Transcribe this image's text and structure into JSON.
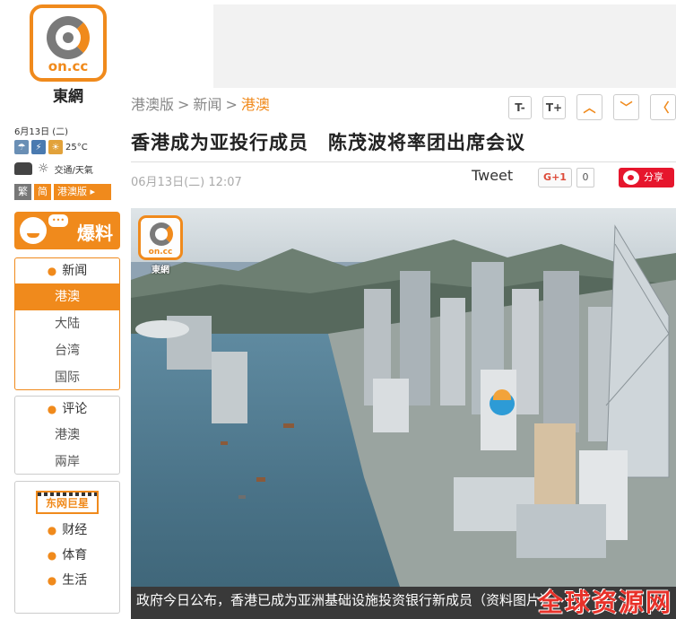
{
  "site": {
    "logo_text": "on.cc",
    "name": "東網"
  },
  "sidebar": {
    "date": "6月13日 (二)",
    "temperature": "25°C",
    "traffic_weather": "交通/天氣",
    "lang": {
      "traditional": "繁",
      "simplified": "简",
      "edition": "港澳版 ▸"
    },
    "baoliao": {
      "bubble": "•••",
      "label": "爆料"
    },
    "news": {
      "header": "新闻",
      "items": [
        "港澳",
        "大陆",
        "台湾",
        "国际"
      ]
    },
    "commentary": {
      "header": "评论",
      "items": [
        "港澳",
        "兩岸"
      ]
    },
    "stars_banner": "东网巨星",
    "more": [
      "财经",
      "体育",
      "生活"
    ]
  },
  "article": {
    "breadcrumb": [
      "港澳版",
      "新闻",
      "港澳"
    ],
    "tools": {
      "font_smaller": "T-",
      "font_larger": "T+",
      "up": "︿",
      "down": "﹀",
      "back": "〈"
    },
    "title": "香港成为亚投行成员　陈茂波将率团出席会议",
    "datetime": "06月13日(二) 12:07",
    "share": {
      "tweet": "Tweet",
      "gplus": "G+1",
      "gplus_count": "0",
      "weibo": "分享"
    },
    "photo_caption": "政府今日公布，香港已成为亚洲基础设施投资银行新成员（资料图片）",
    "watermark": "全球资源网"
  },
  "colors": {
    "brand": "#f08a1c",
    "weibo": "#e6162d",
    "watermark": "#e8322a"
  }
}
